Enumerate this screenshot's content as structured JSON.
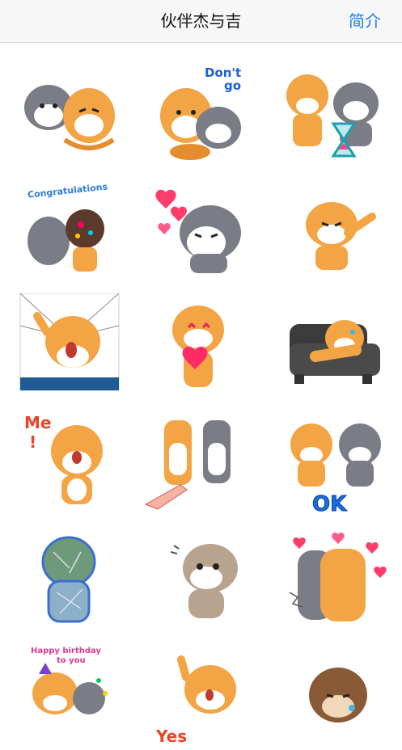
{
  "header": {
    "title": "伙伴杰与吉",
    "action_label": "简介"
  },
  "colors": {
    "accent": "#1a7ff0",
    "shiba": "#f3a545",
    "husky": "#7b7d86",
    "bear": "#8a5a36"
  },
  "stickers": [
    {
      "id": 1,
      "caption": ""
    },
    {
      "id": 2,
      "caption": "Don't go"
    },
    {
      "id": 3,
      "caption": ""
    },
    {
      "id": 4,
      "caption": "Congratulations"
    },
    {
      "id": 5,
      "caption": ""
    },
    {
      "id": 6,
      "caption": ""
    },
    {
      "id": 7,
      "caption": ""
    },
    {
      "id": 8,
      "caption": ""
    },
    {
      "id": 9,
      "caption": ""
    },
    {
      "id": 10,
      "caption": "Me !"
    },
    {
      "id": 11,
      "caption": ""
    },
    {
      "id": 12,
      "caption": "OK"
    },
    {
      "id": 13,
      "caption": ""
    },
    {
      "id": 14,
      "caption": ""
    },
    {
      "id": 15,
      "caption": ""
    },
    {
      "id": 16,
      "caption": "Happy birthday to you"
    },
    {
      "id": 17,
      "caption": "Yes"
    },
    {
      "id": 18,
      "caption": ""
    }
  ],
  "captions": {
    "dont": "Don't",
    "go": "go",
    "congrats": "Congratulations",
    "me": "Me",
    "excl": "!",
    "ok": "OK",
    "happy": "Happy birthday",
    "toyou": "to you",
    "yes": "Yes"
  }
}
